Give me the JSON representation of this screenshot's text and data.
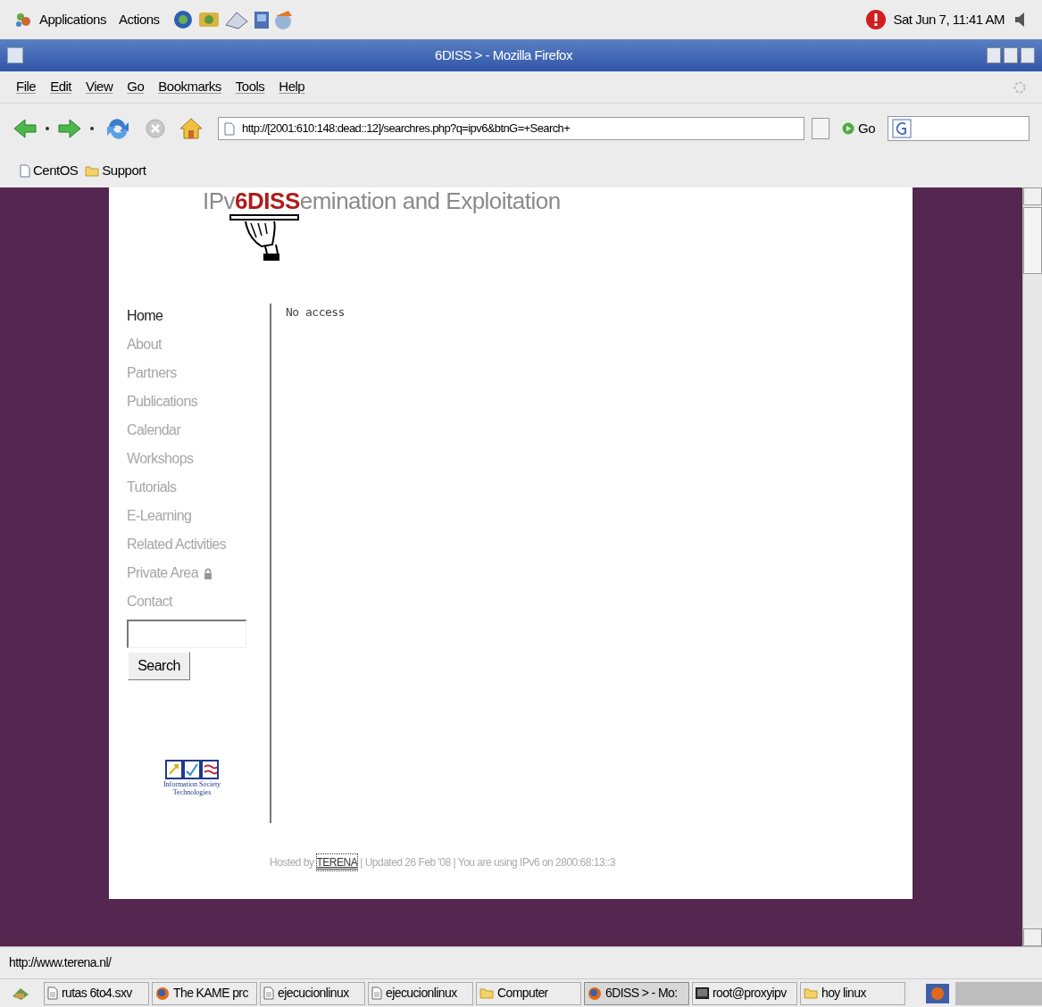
{
  "top_panel": {
    "menus": [
      "Applications",
      "Actions"
    ],
    "clock": "Sat Jun 7, 11:41 AM"
  },
  "window": {
    "title": "6DISS > - Mozilla Firefox"
  },
  "menu_bar": [
    "File",
    "Edit",
    "View",
    "Go",
    "Bookmarks",
    "Tools",
    "Help"
  ],
  "nav_toolbar": {
    "url": "http://[2001:610:148:dead::12]/searchres.php?q=ipv6&btnG=+Search+",
    "go": "Go"
  },
  "bookmarks": [
    {
      "label": "CentOS",
      "kind": "page"
    },
    {
      "label": "Support",
      "kind": "folder"
    }
  ],
  "page": {
    "logo": {
      "prefix": "IPv",
      "highlight": "6DISS",
      "suffix": "emination and Exploitation"
    },
    "nav": [
      {
        "label": "Home",
        "selected": true,
        "kind": "link"
      },
      {
        "label": "About",
        "selected": false,
        "kind": "link"
      },
      {
        "label": "Partners",
        "selected": false,
        "kind": "link"
      },
      {
        "label": "Publications",
        "selected": false,
        "kind": "link"
      },
      {
        "label": "Calendar",
        "selected": false,
        "kind": "link"
      },
      {
        "label": "Workshops",
        "selected": false,
        "kind": "link"
      },
      {
        "label": "Tutorials",
        "selected": false,
        "kind": "link"
      },
      {
        "label": "E-Learning",
        "selected": false,
        "kind": "link"
      },
      {
        "label": "Related Activities",
        "selected": false,
        "kind": "link"
      },
      {
        "label": "Private Area",
        "selected": false,
        "kind": "locked"
      },
      {
        "label": "Contact",
        "selected": false,
        "kind": "link"
      }
    ],
    "search_button": "Search",
    "sponsor": {
      "line_1": "Information Society",
      "line_2": "Technologies"
    },
    "message": "No access",
    "footer": {
      "hosted_by": "Hosted by",
      "host_link": "TERENA",
      "rest": "| Updated 26 Feb '08 | You are using IPv6 on 2800:68:13::3"
    }
  },
  "status_bar": "http://www.terena.nl/",
  "taskbar": [
    {
      "label": "rutas 6to4.sxv",
      "kind": "document",
      "selected": false
    },
    {
      "label": "The KAME prc",
      "kind": "browser",
      "selected": false
    },
    {
      "label": "ejecucionlinux",
      "kind": "document",
      "selected": false
    },
    {
      "label": "ejecucionlinux",
      "kind": "document",
      "selected": false
    },
    {
      "label": "Computer",
      "kind": "folder",
      "selected": false
    },
    {
      "label": "6DISS > - Mo:",
      "kind": "browser",
      "selected": true
    },
    {
      "label": "root@proxyipv",
      "kind": "terminal",
      "selected": false
    },
    {
      "label": "hoy linux",
      "kind": "folder",
      "selected": false
    }
  ]
}
